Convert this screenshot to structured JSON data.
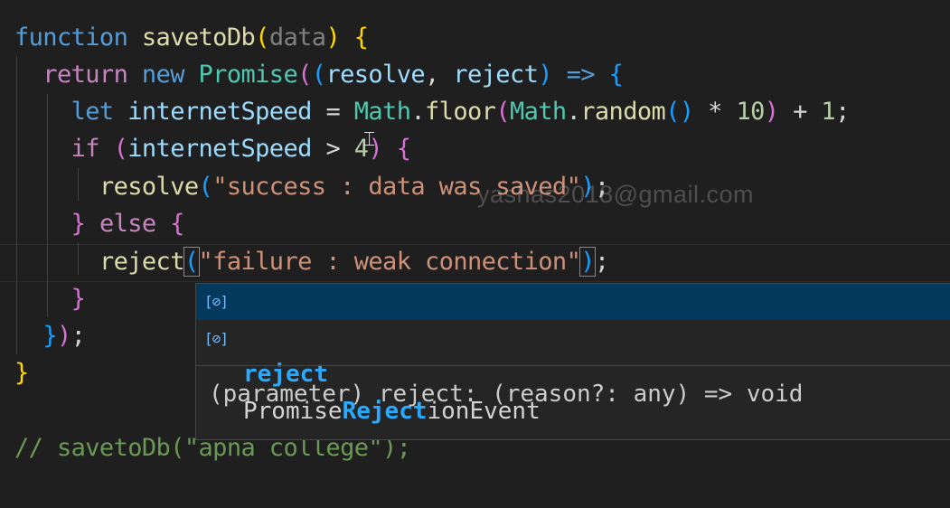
{
  "code": {
    "line1": {
      "kw": "function",
      "name": "savetoDb",
      "open": "(",
      "param": "data",
      "close": ")",
      "brace": "{"
    },
    "line2": {
      "kw": "return",
      "new": "new",
      "cls": "Promise",
      "open1": "(",
      "open2": "(",
      "p1": "resolve",
      "comma": ",",
      "p2": "reject",
      "close": ")",
      "arrow": "=>",
      "brace": "{"
    },
    "line3": {
      "kw": "let",
      "var": "internetSpeed",
      "eq": "=",
      "math1": "Math",
      "dot1": ".",
      "floor": "floor",
      "open": "(",
      "math2": "Math",
      "dot2": ".",
      "random": "random",
      "call": "()",
      "mul": "*",
      "ten": "10",
      "close": ")",
      "plus": "+",
      "one": "1",
      "semi": ";"
    },
    "line4": {
      "kw": "if",
      "open": "(",
      "var": "internetSpeed",
      "gt": ">",
      "four": "4",
      "close": ")",
      "brace": "{"
    },
    "line5": {
      "fn": "resolve",
      "open": "(",
      "str": "\"success : data was saved\"",
      "close": ")",
      "semi": ";"
    },
    "line6": {
      "brace1": "}",
      "kw": "else",
      "brace2": "{"
    },
    "line7": {
      "fn": "reject",
      "open": "(",
      "str": "\"failure : weak connection\"",
      "close": ")",
      "semi": ";"
    },
    "line8": {
      "brace": "}"
    },
    "line9": {
      "brace": "}",
      "paren": ")",
      "semi": ";"
    },
    "line10": {
      "brace": "}"
    },
    "line12": {
      "comment": "// savetoDb(\"apna college\");"
    }
  },
  "watermark": "yashas2018@gmail.com",
  "suggest": {
    "items": [
      {
        "icon": "[⊘]",
        "label": "reject"
      },
      {
        "icon": "[⊘]",
        "pre": "Promise",
        "match": "Reject",
        "post": "ionEvent"
      }
    ],
    "detail": "(parameter) reject: (reason?: any) => void"
  }
}
